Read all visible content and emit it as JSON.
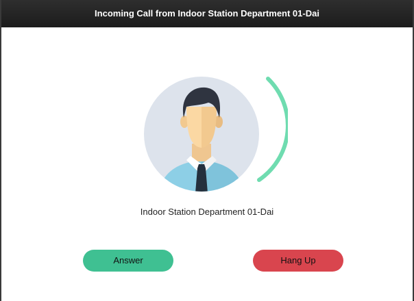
{
  "window": {
    "title": "Incoming Call from Indoor Station Department 01-Dai"
  },
  "caller": {
    "name": "Indoor Station Department 01-Dai"
  },
  "actions": {
    "answer_label": "Answer",
    "hangup_label": "Hang Up"
  },
  "colors": {
    "answer": "#3fc092",
    "hangup": "#d9454e",
    "ring": "#6fdcb0",
    "avatar_bg": "#dde3ec"
  },
  "icons": {
    "avatar": "user-avatar-icon"
  }
}
